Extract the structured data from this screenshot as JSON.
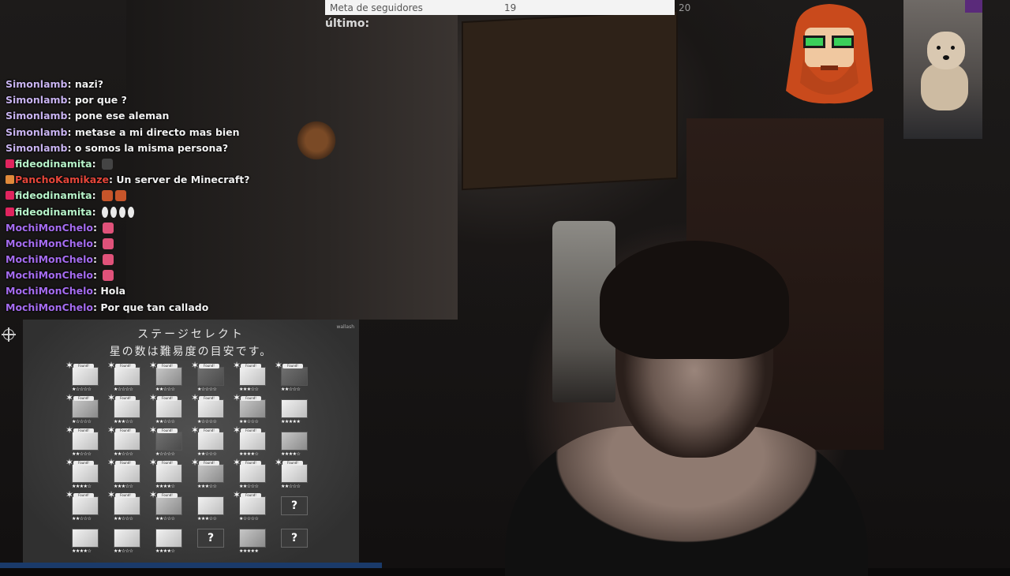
{
  "follower_goal": {
    "label": "Meta de seguidores",
    "current": "19",
    "target": "20",
    "last_label": "último:"
  },
  "chat": [
    {
      "user": "Simonlamb",
      "color": "#c8b3f0",
      "badge": null,
      "text": "nazi?"
    },
    {
      "user": "Simonlamb",
      "color": "#c8b3f0",
      "badge": null,
      "text": "por que ?"
    },
    {
      "user": "Simonlamb",
      "color": "#c8b3f0",
      "badge": null,
      "text": "pone ese aleman"
    },
    {
      "user": "Simonlamb",
      "color": "#c8b3f0",
      "badge": null,
      "text": "metase a mi directo mas bien"
    },
    {
      "user": "Simonlamb",
      "color": "#c8b3f0",
      "badge": null,
      "text": "o somos la misma persona?"
    },
    {
      "user": "fideodinamita",
      "color": "#b7f3c9",
      "badge": "#e0245e",
      "text": "",
      "emotes": 1
    },
    {
      "user": "PanchoKamikaze",
      "color": "#e5463a",
      "badge": "#e08a3a",
      "text": "Un server de Minecraft?"
    },
    {
      "user": "fideodinamita",
      "color": "#b7f3c9",
      "badge": "#e0245e",
      "text": "",
      "emotes": 2
    },
    {
      "user": "fideodinamita",
      "color": "#b7f3c9",
      "badge": "#e0245e",
      "text": "",
      "emotes": 4
    },
    {
      "user": "MochiMonChelo",
      "color": "#a56cf0",
      "badge": null,
      "text": "",
      "emotes": 1
    },
    {
      "user": "MochiMonChelo",
      "color": "#a56cf0",
      "badge": null,
      "text": "",
      "emotes": 1
    },
    {
      "user": "MochiMonChelo",
      "color": "#a56cf0",
      "badge": null,
      "text": "",
      "emotes": 1
    },
    {
      "user": "MochiMonChelo",
      "color": "#a56cf0",
      "badge": null,
      "text": "",
      "emotes": 1
    },
    {
      "user": "MochiMonChelo",
      "color": "#a56cf0",
      "badge": null,
      "text": "Hola"
    },
    {
      "user": "MochiMonChelo",
      "color": "#a56cf0",
      "badge": null,
      "text": "Por que tan callado"
    }
  ],
  "game": {
    "title": "ステージセレクト",
    "subtitle": "星の数は難易度の目安です。",
    "corner": "wallash",
    "found_label": "Found!",
    "unknown_label": "?",
    "stages": [
      {
        "state": "found",
        "tone": "light",
        "rating": "★☆☆☆☆"
      },
      {
        "state": "found",
        "tone": "light",
        "rating": "★☆☆☆☆"
      },
      {
        "state": "found",
        "tone": "mid",
        "rating": "★★☆☆☆"
      },
      {
        "state": "found",
        "tone": "dark",
        "rating": "★☆☆☆☆"
      },
      {
        "state": "found",
        "tone": "light",
        "rating": "★★★☆☆"
      },
      {
        "state": "found",
        "tone": "dark",
        "rating": "★★☆☆☆"
      },
      {
        "state": "found",
        "tone": "mid",
        "rating": "★☆☆☆☆"
      },
      {
        "state": "found",
        "tone": "light",
        "rating": "★★★☆☆"
      },
      {
        "state": "found",
        "tone": "light",
        "rating": "★★☆☆☆"
      },
      {
        "state": "found",
        "tone": "light",
        "rating": "★☆☆☆☆"
      },
      {
        "state": "found",
        "tone": "mid",
        "rating": "★★☆☆☆"
      },
      {
        "state": "new",
        "tone": "light",
        "rating": "★★★★★"
      },
      {
        "state": "found",
        "tone": "light",
        "rating": "★★☆☆☆"
      },
      {
        "state": "found",
        "tone": "light",
        "rating": "★★☆☆☆"
      },
      {
        "state": "found",
        "tone": "dark",
        "rating": "★☆☆☆☆"
      },
      {
        "state": "found",
        "tone": "light",
        "rating": "★★☆☆☆"
      },
      {
        "state": "found",
        "tone": "light",
        "rating": "★★★★☆"
      },
      {
        "state": "new",
        "tone": "mid",
        "rating": "★★★★☆"
      },
      {
        "state": "found",
        "tone": "light",
        "rating": "★★★★☆"
      },
      {
        "state": "found",
        "tone": "light",
        "rating": "★★★☆☆"
      },
      {
        "state": "found",
        "tone": "light",
        "rating": "★★★★☆"
      },
      {
        "state": "found",
        "tone": "mid",
        "rating": "★★★☆☆"
      },
      {
        "state": "found",
        "tone": "light",
        "rating": "★★☆☆☆"
      },
      {
        "state": "found",
        "tone": "light",
        "rating": "★★☆☆☆"
      },
      {
        "state": "found",
        "tone": "light",
        "rating": "★★☆☆☆"
      },
      {
        "state": "found",
        "tone": "light",
        "rating": "★★☆☆☆"
      },
      {
        "state": "found",
        "tone": "mid",
        "rating": "★★☆☆☆"
      },
      {
        "state": "new",
        "tone": "light",
        "rating": "★★★☆☆"
      },
      {
        "state": "found",
        "tone": "light",
        "rating": "★☆☆☆☆"
      },
      {
        "state": "unknown",
        "tone": "dark",
        "rating": ""
      },
      {
        "state": "new",
        "tone": "light",
        "rating": "★★★★☆"
      },
      {
        "state": "new",
        "tone": "light",
        "rating": "★★☆☆☆"
      },
      {
        "state": "new",
        "tone": "light",
        "rating": "★★★★☆"
      },
      {
        "state": "unknown",
        "tone": "dark",
        "rating": ""
      },
      {
        "state": "new",
        "tone": "mid",
        "rating": "★★★★★"
      },
      {
        "state": "unknown",
        "tone": "dark",
        "rating": ""
      }
    ]
  }
}
